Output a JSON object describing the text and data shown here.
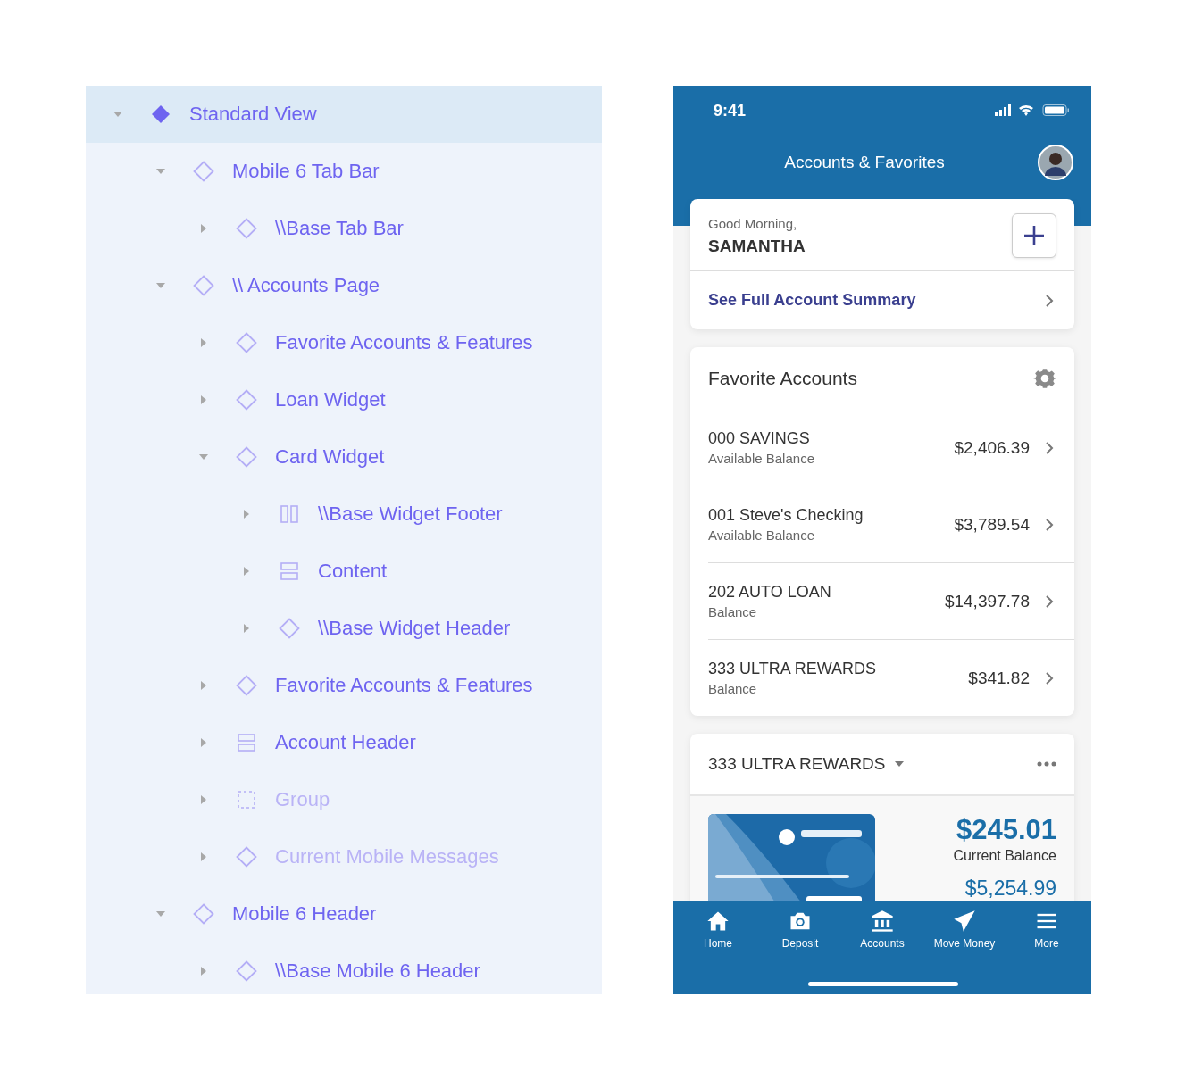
{
  "layers": [
    {
      "label": "Standard View",
      "kind": "main",
      "expanded": true,
      "selected": true,
      "hidden": false,
      "children": [
        {
          "label": "Mobile 6 Tab Bar",
          "kind": "instance",
          "expanded": true,
          "selected": false,
          "hidden": false,
          "children": [
            {
              "label": "\\\\Base Tab Bar",
              "kind": "instance",
              "expanded": false,
              "selected": false,
              "hidden": false
            }
          ]
        },
        {
          "label": "\\\\ Accounts Page",
          "kind": "instance",
          "expanded": true,
          "selected": false,
          "hidden": false,
          "children": [
            {
              "label": "Favorite Accounts & Features",
              "kind": "instance",
              "expanded": false,
              "selected": false,
              "hidden": false
            },
            {
              "label": "Loan Widget",
              "kind": "instance",
              "expanded": false,
              "selected": false,
              "hidden": false
            },
            {
              "label": "Card Widget",
              "kind": "instance",
              "expanded": true,
              "selected": false,
              "hidden": false,
              "children": [
                {
                  "label": "\\\\Base Widget Footer",
                  "kind": "columns",
                  "expanded": false,
                  "selected": false,
                  "hidden": false
                },
                {
                  "label": "Content",
                  "kind": "rows",
                  "expanded": false,
                  "selected": false,
                  "hidden": false
                },
                {
                  "label": "\\\\Base Widget Header",
                  "kind": "instance",
                  "expanded": false,
                  "selected": false,
                  "hidden": false
                }
              ]
            },
            {
              "label": "Favorite Accounts & Features",
              "kind": "instance",
              "expanded": false,
              "selected": false,
              "hidden": false
            },
            {
              "label": "Account Header",
              "kind": "rows",
              "expanded": false,
              "selected": false,
              "hidden": false
            },
            {
              "label": "Group",
              "kind": "group",
              "expanded": false,
              "selected": false,
              "hidden": true
            },
            {
              "label": "Current Mobile Messages",
              "kind": "instance",
              "expanded": false,
              "selected": false,
              "hidden": true
            }
          ]
        },
        {
          "label": "Mobile 6 Header",
          "kind": "instance",
          "expanded": true,
          "selected": false,
          "hidden": false,
          "children": [
            {
              "label": "\\\\Base Mobile 6 Header",
              "kind": "instance",
              "expanded": false,
              "selected": false,
              "hidden": false
            }
          ]
        }
      ]
    }
  ],
  "phone": {
    "status_bar": {
      "time": "9:41"
    },
    "title": "Accounts & Favorites",
    "greeting": {
      "salutation": "Good Morning,",
      "name": "SAMANTHA"
    },
    "summary_link": "See Full Account Summary",
    "favorites": {
      "title": "Favorite Accounts",
      "accounts": [
        {
          "name": "000 SAVINGS",
          "balance_label": "Available Balance",
          "amount": "$2,406.39"
        },
        {
          "name": "001 Steve's Checking",
          "balance_label": "Available Balance",
          "amount": "$3,789.54"
        },
        {
          "name": "202 AUTO LOAN",
          "balance_label": "Balance",
          "amount": "$14,397.78"
        },
        {
          "name": "333 ULTRA REWARDS",
          "balance_label": "Balance",
          "amount": "$341.82"
        }
      ]
    },
    "card_widget": {
      "account": "333 ULTRA REWARDS",
      "current_balance": "$245.01",
      "current_balance_label": "Current Balance",
      "second_amount": "$5,254.99"
    },
    "tab_bar": [
      {
        "label": "Home",
        "kind": "home"
      },
      {
        "label": "Deposit",
        "kind": "camera"
      },
      {
        "label": "Accounts",
        "kind": "bank"
      },
      {
        "label": "Move Money",
        "kind": "send"
      },
      {
        "label": "More",
        "kind": "menu"
      }
    ]
  }
}
